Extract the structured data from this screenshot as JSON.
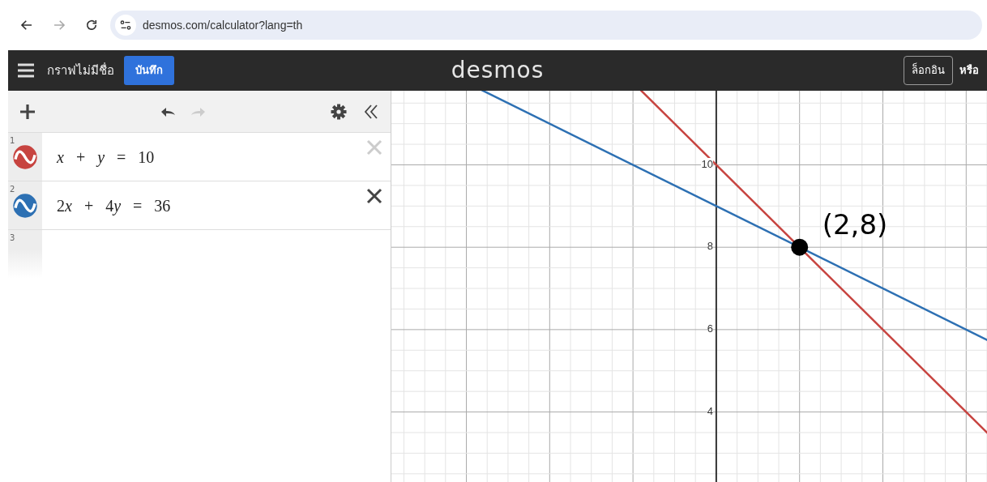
{
  "browser": {
    "url": "desmos.com/calculator?lang=th",
    "back_disabled": false,
    "forward_disabled": true
  },
  "header": {
    "title": "กราฟไม่มีชื่อ",
    "save_button": "บันทึก",
    "logo": "desmos",
    "login_button": "ล็อกอิน",
    "or_text": "หรือ"
  },
  "toolbar": {
    "undo_disabled": false,
    "redo_disabled": true
  },
  "expressions": [
    {
      "number": "1",
      "color": "#c74440",
      "latex": "x + y = 10",
      "hovered": false
    },
    {
      "number": "2",
      "color": "#2d70b3",
      "latex": "2x + 4y = 36",
      "hovered": true
    },
    {
      "number": "3"
    }
  ],
  "graph": {
    "y_tick_labels": [
      "10",
      "8",
      "6",
      "4"
    ],
    "point_label": "(2,8)"
  }
}
